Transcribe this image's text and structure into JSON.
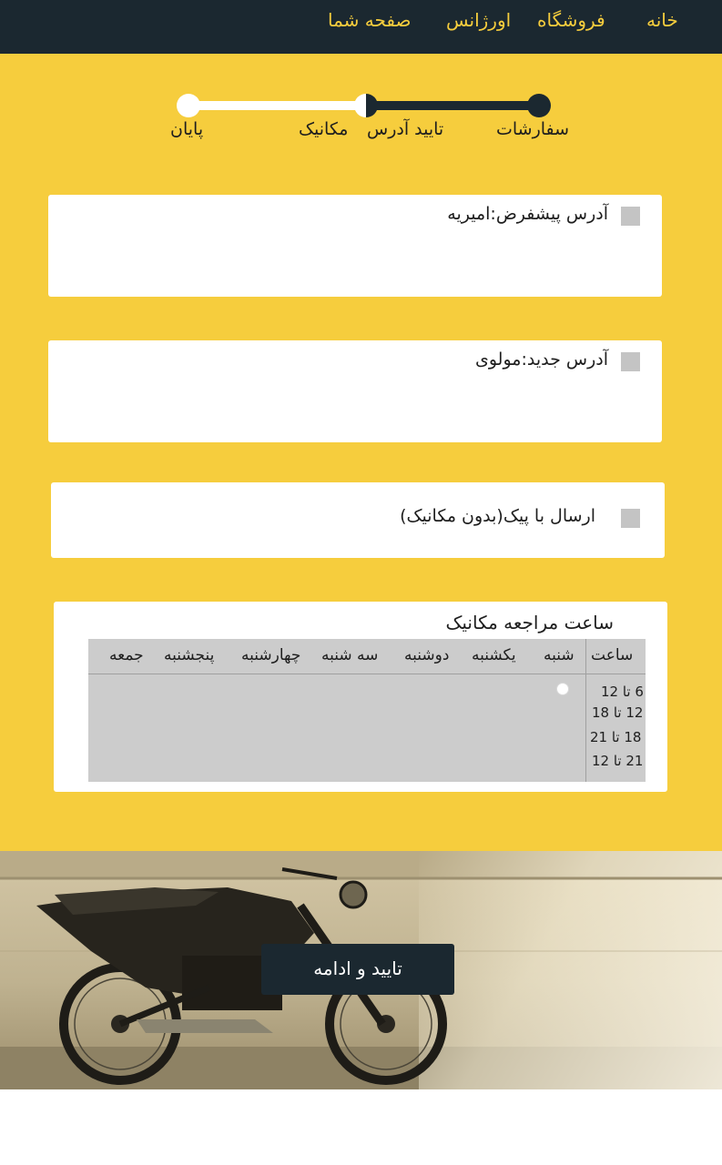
{
  "nav": {
    "home": "خانه",
    "shop": "فروشگاه",
    "emergency": "اورژانس",
    "profile": "صفحه شما"
  },
  "steps": {
    "orders": "سفارشات",
    "confirm_address": "تایید آدرس",
    "mechanic": "مکانیک",
    "end": "پایان"
  },
  "addresses": {
    "default": "آدرس پیشفرض:امیریه",
    "new": "آدرس جدید:مولوی",
    "courier": "ارسال با پیک(بدون مکانیک)"
  },
  "schedule": {
    "title": "ساعت مراجعه مکانیک",
    "time_header": "ساعت",
    "days": [
      "شنبه",
      "یکشنبه",
      "دوشنبه",
      "سه شنبه",
      "چهارشنبه",
      "پنجشنبه",
      "جمعه"
    ],
    "slots": [
      "6 تا 12",
      "12 تا 18",
      "18 تا 21",
      "21 تا 12"
    ]
  },
  "cta": {
    "label": "تایید و ادامه"
  },
  "colors": {
    "accent_yellow": "#f6cd3d",
    "dark_navy": "#1b2830"
  }
}
